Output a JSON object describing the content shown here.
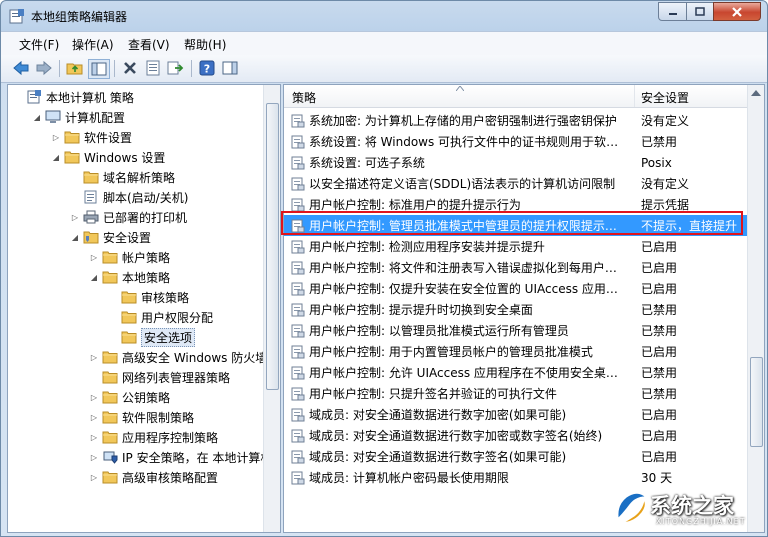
{
  "window": {
    "title": "本地组策略编辑器"
  },
  "menu": [
    "文件(F)",
    "操作(A)",
    "查看(V)",
    "帮助(H)"
  ],
  "tree": {
    "items": [
      {
        "label": "本地计算机 策略",
        "icon": "computer-policy-icon",
        "expander": "",
        "depth": 0
      },
      {
        "label": "计算机配置",
        "icon": "computer-icon",
        "expander": "◢",
        "depth": 1
      },
      {
        "label": "软件设置",
        "icon": "folder-icon",
        "expander": "▷",
        "depth": 2
      },
      {
        "label": "Windows 设置",
        "icon": "folder-icon",
        "expander": "◢",
        "depth": 2
      },
      {
        "label": "域名解析策略",
        "icon": "folder-icon",
        "expander": "",
        "depth": 3
      },
      {
        "label": "脚本(启动/关机)",
        "icon": "script-icon",
        "expander": "",
        "depth": 3
      },
      {
        "label": "已部署的打印机",
        "icon": "printer-icon",
        "expander": "▷",
        "depth": 3
      },
      {
        "label": "安全设置",
        "icon": "security-folder-icon",
        "expander": "◢",
        "depth": 3
      },
      {
        "label": "帐户策略",
        "icon": "folder-icon",
        "expander": "▷",
        "depth": 4
      },
      {
        "label": "本地策略",
        "icon": "folder-icon",
        "expander": "◢",
        "depth": 4
      },
      {
        "label": "审核策略",
        "icon": "folder-icon",
        "expander": "",
        "depth": 5
      },
      {
        "label": "用户权限分配",
        "icon": "folder-icon",
        "expander": "",
        "depth": 5
      },
      {
        "label": "安全选项",
        "icon": "folder-icon",
        "expander": "",
        "depth": 5,
        "selected": true
      },
      {
        "label": "高级安全 Windows 防火墙",
        "icon": "folder-icon",
        "expander": "▷",
        "depth": 4
      },
      {
        "label": "网络列表管理器策略",
        "icon": "folder-icon",
        "expander": "",
        "depth": 4
      },
      {
        "label": "公钥策略",
        "icon": "folder-icon",
        "expander": "▷",
        "depth": 4
      },
      {
        "label": "软件限制策略",
        "icon": "folder-icon",
        "expander": "▷",
        "depth": 4
      },
      {
        "label": "应用程序控制策略",
        "icon": "folder-icon",
        "expander": "▷",
        "depth": 4
      },
      {
        "label": "IP 安全策略，在 本地计算机",
        "icon": "ip-security-icon",
        "expander": "▷",
        "depth": 4
      },
      {
        "label": "高级审核策略配置",
        "icon": "folder-icon",
        "expander": "▷",
        "depth": 4
      }
    ]
  },
  "list": {
    "columns": [
      "策略",
      "安全设置"
    ],
    "rows": [
      {
        "policy": "系统加密: 为计算机上存储的用户密钥强制进行强密钥保护",
        "setting": "没有定义"
      },
      {
        "policy": "系统设置: 将 Windows 可执行文件中的证书规则用于软件…",
        "setting": "已禁用"
      },
      {
        "policy": "系统设置: 可选子系统",
        "setting": "Posix"
      },
      {
        "policy": "以安全描述符定义语言(SDDL)语法表示的计算机访问限制",
        "setting": "没有定义"
      },
      {
        "policy": "用户帐户控制: 标准用户的提升提示行为",
        "setting": "提示凭据"
      },
      {
        "policy": "用户帐户控制: 管理员批准模式中管理员的提升权限提示的…",
        "setting": "不提示，直接提升",
        "selected": true
      },
      {
        "policy": "用户帐户控制: 检测应用程序安装并提示提升",
        "setting": "已启用"
      },
      {
        "policy": "用户帐户控制: 将文件和注册表写入错误虚拟化到每用户位置",
        "setting": "已启用"
      },
      {
        "policy": "用户帐户控制: 仅提升安装在安全位置的 UIAccess 应用程序",
        "setting": "已启用"
      },
      {
        "policy": "用户帐户控制: 提示提升时切换到安全桌面",
        "setting": "已禁用"
      },
      {
        "policy": "用户帐户控制: 以管理员批准模式运行所有管理员",
        "setting": "已禁用"
      },
      {
        "policy": "用户帐户控制: 用于内置管理员帐户的管理员批准模式",
        "setting": "已启用"
      },
      {
        "policy": "用户帐户控制: 允许 UIAccess 应用程序在不使用安全桌面…",
        "setting": "已禁用"
      },
      {
        "policy": "用户帐户控制: 只提升签名并验证的可执行文件",
        "setting": "已禁用"
      },
      {
        "policy": "域成员: 对安全通道数据进行数字加密(如果可能)",
        "setting": "已启用"
      },
      {
        "policy": "域成员: 对安全通道数据进行数字加密或数字签名(始终)",
        "setting": "已启用"
      },
      {
        "policy": "域成员: 对安全通道数据进行数字签名(如果可能)",
        "setting": "已启用"
      },
      {
        "policy": "域成员: 计算机帐户密码最长使用期限",
        "setting": "30 天"
      }
    ]
  },
  "watermark": {
    "text": "系统之家",
    "sub": "XITONGZHIJIA.NET"
  },
  "colors": {
    "selection": "#3399ff",
    "highlight_border": "#e0141c",
    "folder": "#f1c75a"
  }
}
